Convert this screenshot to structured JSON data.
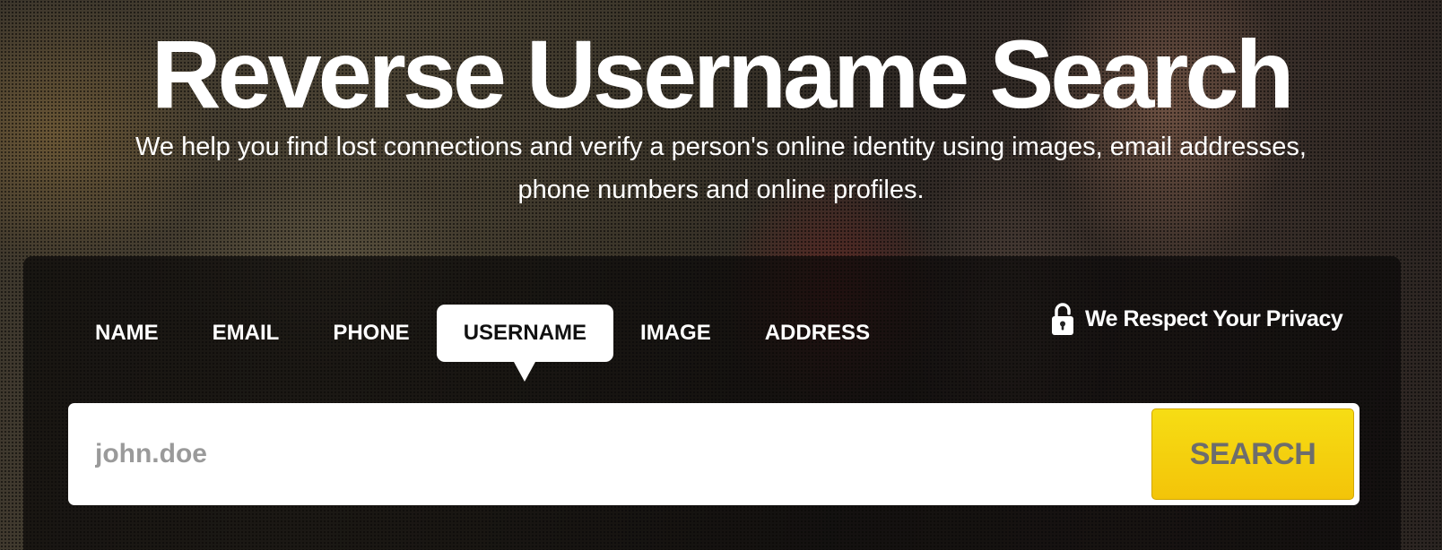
{
  "hero": {
    "title": "Reverse Username Search",
    "subtitle_line1": "We help you find lost connections and verify a person's online identity using images, email addresses,",
    "subtitle_line2": "phone numbers and online profiles."
  },
  "tabs": [
    {
      "label": "NAME",
      "active": false
    },
    {
      "label": "EMAIL",
      "active": false
    },
    {
      "label": "PHONE",
      "active": false
    },
    {
      "label": "USERNAME",
      "active": true
    },
    {
      "label": "IMAGE",
      "active": false
    },
    {
      "label": "ADDRESS",
      "active": false
    }
  ],
  "privacy": {
    "label": "We Respect Your Privacy",
    "icon": "lock-icon"
  },
  "search": {
    "placeholder": "john.doe",
    "value": "",
    "button_label": "SEARCH"
  },
  "colors": {
    "accent": "#f5d210",
    "button_text": "#6d6d6d",
    "text_light": "#ffffff"
  }
}
